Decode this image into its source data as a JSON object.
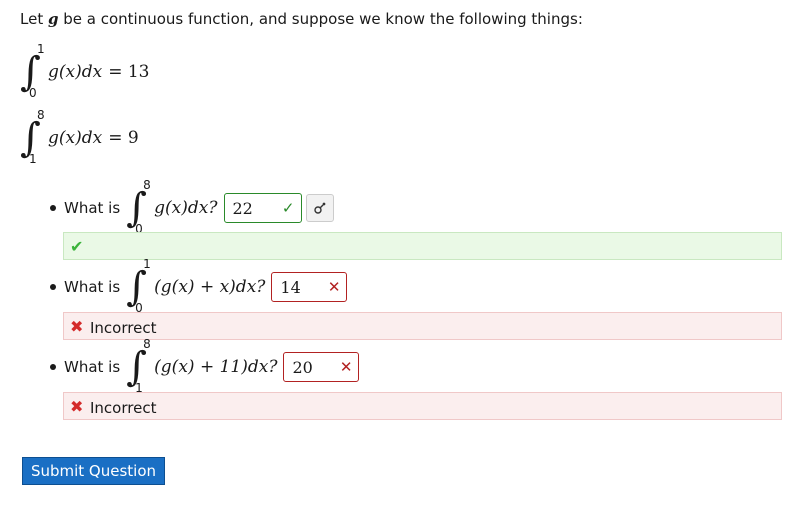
{
  "intro": {
    "prefix": "Let",
    "var": "g",
    "suffix": "be a continuous function, and suppose we know the following things:"
  },
  "given": [
    {
      "upper": "1",
      "lower": "0",
      "expr": "g(x)dx",
      "rhs": "= 13"
    },
    {
      "upper": "8",
      "lower": "1",
      "expr": "g(x)dx",
      "rhs": "= 9"
    }
  ],
  "questions": [
    {
      "label": "What is",
      "upper": "8",
      "lower": "0",
      "expr": "g(x)dx?",
      "answer": "22",
      "status": "correct",
      "mark": "✓",
      "feedback": ""
    },
    {
      "label": "What is",
      "upper": "1",
      "lower": "0",
      "expr": "(g(x) + x)dx?",
      "answer": "14",
      "status": "incorrect",
      "mark": "✕",
      "feedback": "Incorrect"
    },
    {
      "label": "What is",
      "upper": "8",
      "lower": "1",
      "expr": "(g(x) + 11)dx?",
      "answer": "20",
      "status": "incorrect",
      "mark": "✕",
      "feedback": "Incorrect"
    }
  ],
  "submit": {
    "label": "Submit Question"
  },
  "colors": {
    "correct": "#2a8a2a",
    "incorrect": "#b22222",
    "submit_bg": "#1a6fc4",
    "correct_bg": "#eaf9e6",
    "incorrect_bg": "#fbeeee"
  },
  "icons": {
    "key": "key-icon",
    "check": "check-icon",
    "cross": "cross-icon"
  }
}
